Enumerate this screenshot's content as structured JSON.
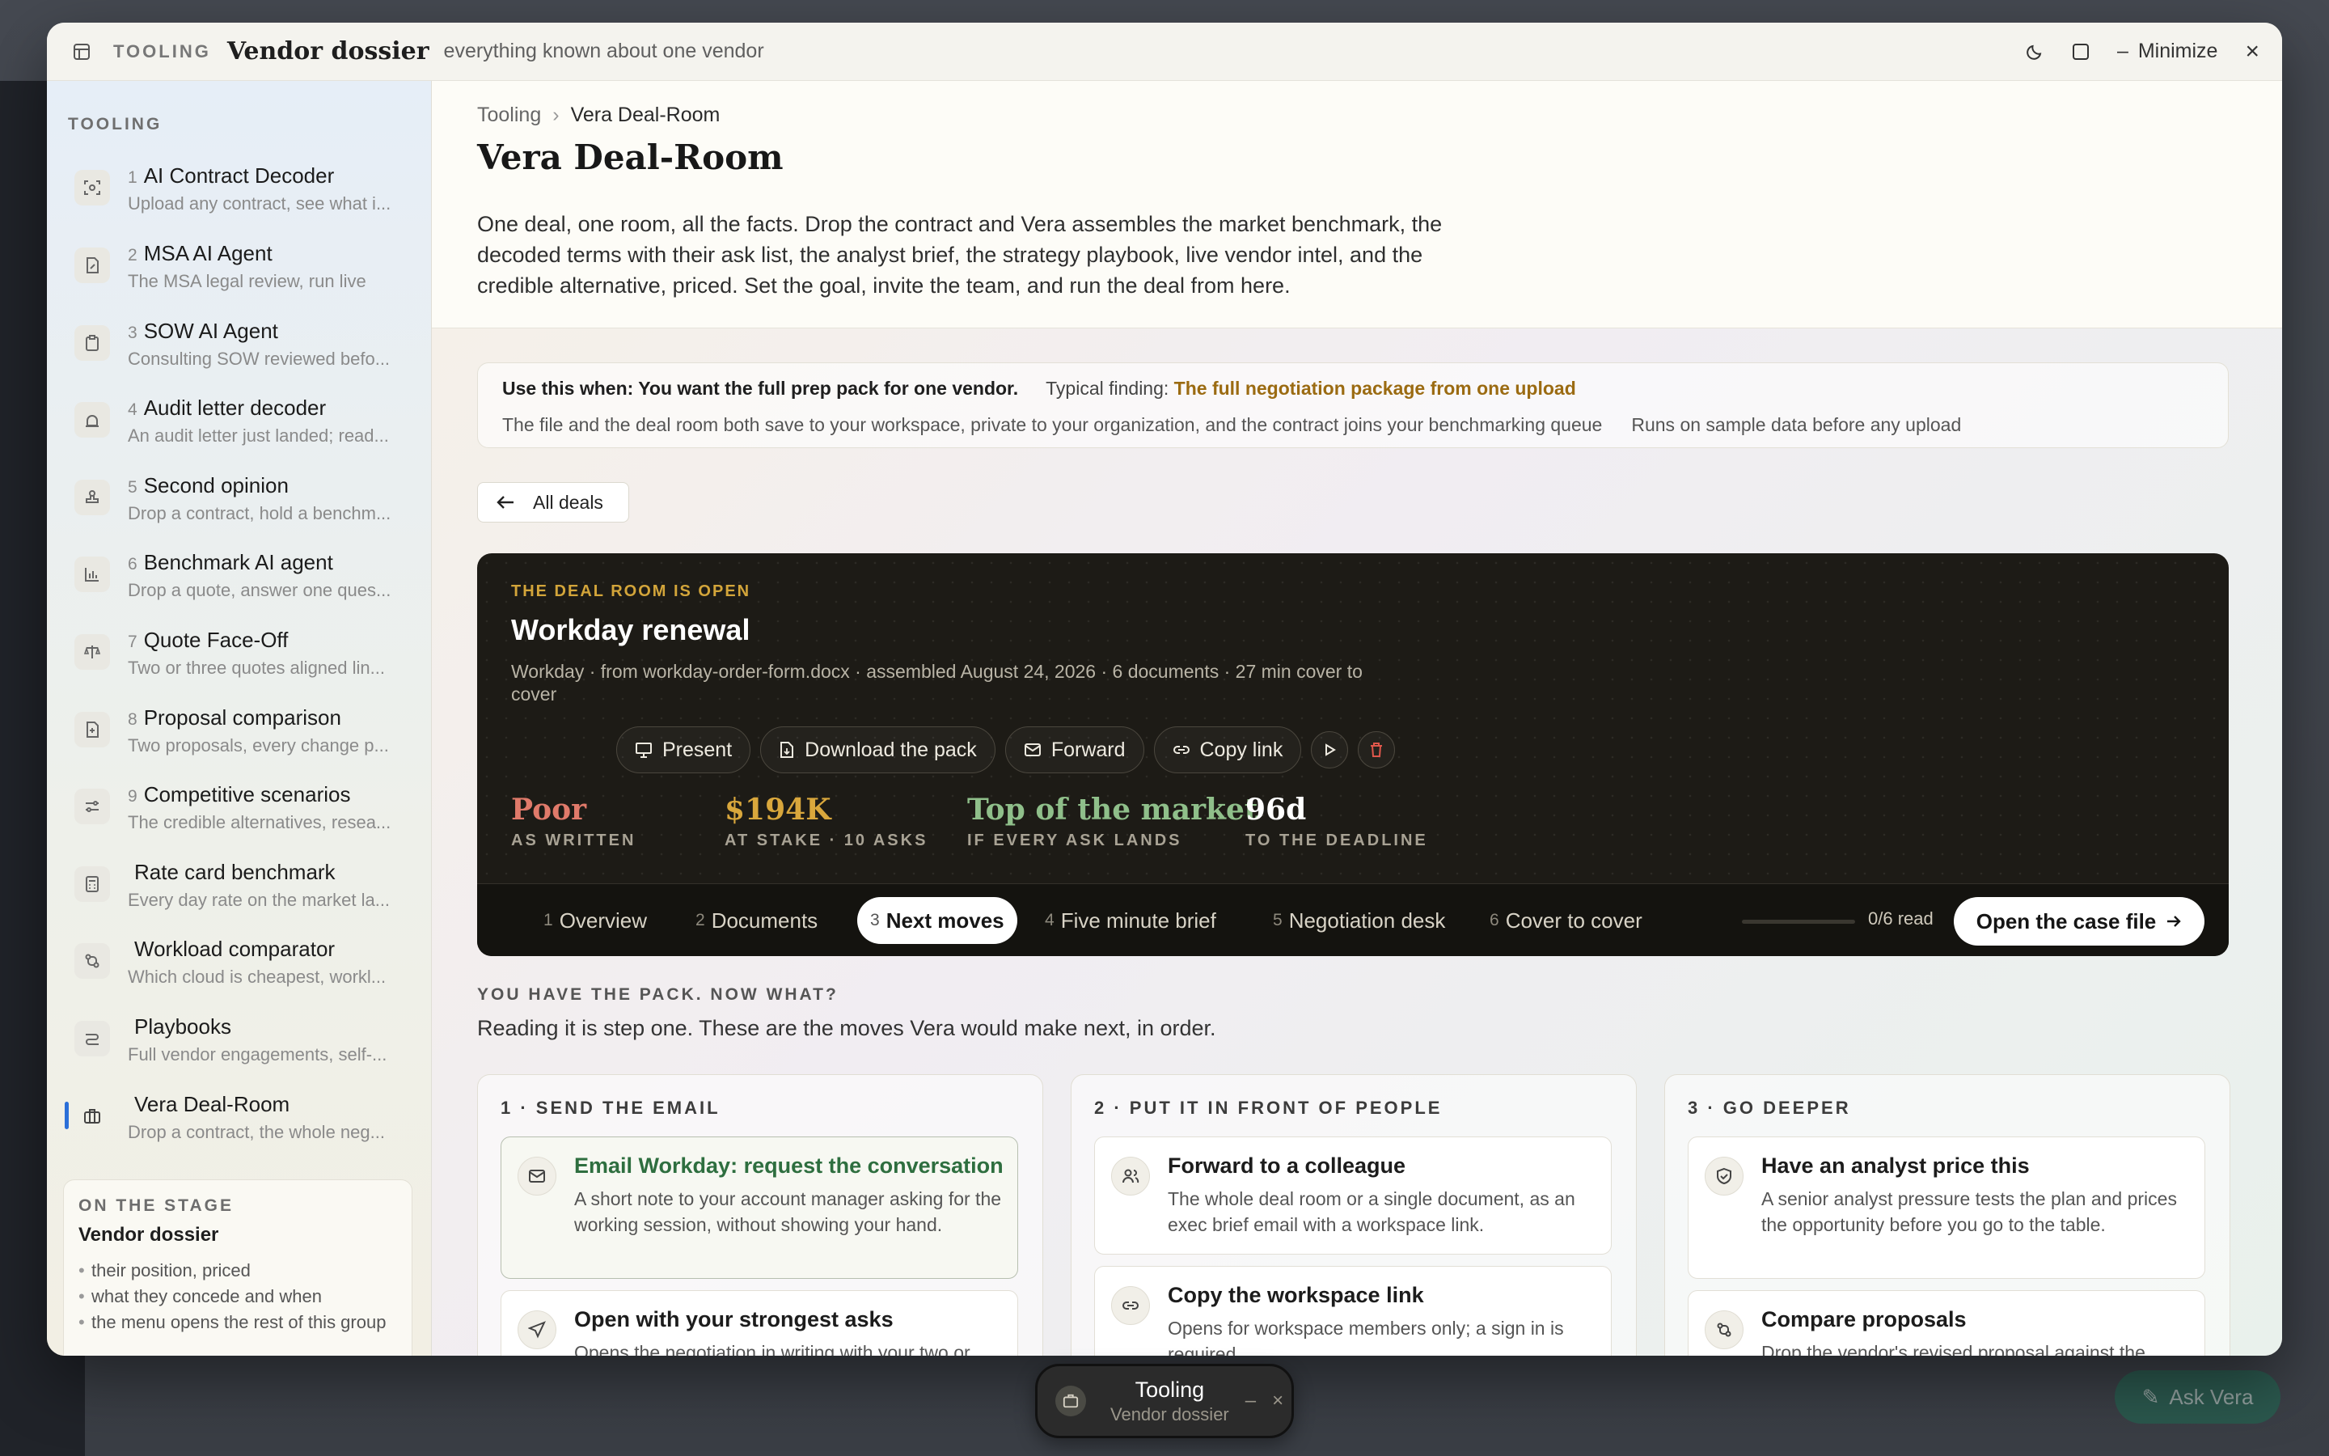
{
  "window": {
    "kicker": "TOOLING",
    "title": "Vendor dossier",
    "subtitle": "everything known about one vendor",
    "minimize_label": "Minimize"
  },
  "sidebar": {
    "heading": "TOOLING",
    "items": [
      {
        "num": "1",
        "title": "AI Contract Decoder",
        "desc": "Upload any contract, see what i...",
        "icon": "scan-icon"
      },
      {
        "num": "2",
        "title": "MSA AI Agent",
        "desc": "The MSA legal review, run live",
        "icon": "document-edit-icon"
      },
      {
        "num": "3",
        "title": "SOW AI Agent",
        "desc": "Consulting SOW reviewed befo...",
        "icon": "clipboard-icon"
      },
      {
        "num": "4",
        "title": "Audit letter decoder",
        "desc": "An audit letter just landed; read...",
        "icon": "alarm-icon"
      },
      {
        "num": "5",
        "title": "Second opinion",
        "desc": "Drop a contract, hold a benchm...",
        "icon": "stamp-icon"
      },
      {
        "num": "6",
        "title": "Benchmark AI agent",
        "desc": "Drop a quote, answer one ques...",
        "icon": "bar-chart-icon"
      },
      {
        "num": "7",
        "title": "Quote Face-Off",
        "desc": "Two or three quotes aligned lin...",
        "icon": "scales-icon"
      },
      {
        "num": "8",
        "title": "Proposal comparison",
        "desc": "Two proposals, every change p...",
        "icon": "file-compare-icon"
      },
      {
        "num": "9",
        "title": "Competitive scenarios",
        "desc": "The credible alternatives, resea...",
        "icon": "sliders-icon"
      },
      {
        "num": "",
        "title": "Rate card benchmark",
        "desc": "Every day rate on the market la...",
        "icon": "calculator-icon"
      },
      {
        "num": "",
        "title": "Workload comparator",
        "desc": "Which cloud is cheapest, workl...",
        "icon": "git-compare-icon"
      },
      {
        "num": "",
        "title": "Playbooks",
        "desc": "Full vendor engagements, self-...",
        "icon": "workflow-icon"
      },
      {
        "num": "",
        "title": "Vera Deal-Room",
        "desc": "Drop a contract, the whole neg...",
        "icon": "briefcase-icon"
      }
    ],
    "stage": {
      "kicker": "ON THE STAGE",
      "title": "Vendor dossier",
      "points": [
        "their position, priced",
        "what they concede and when",
        "the menu opens the rest of this group"
      ]
    }
  },
  "main": {
    "breadcrumb": {
      "parent": "Tooling",
      "current": "Vera Deal-Room"
    },
    "title": "Vera Deal-Room",
    "description": "One deal, one room, all the facts. Drop the contract and Vera assembles the market benchmark, the decoded terms with their ask list, the analyst brief, the strategy playbook, live vendor intel, and the credible alternative, priced. Set the goal, invite the team, and run the deal from here.",
    "use_when": {
      "lead": "Use this when: You want the full prep pack for one vendor.",
      "finding_label": "Typical finding:",
      "finding_value": "The full negotiation package from one upload",
      "note1": "The file and the deal room both save to your workspace, private to your organization, and the contract joins your benchmarking queue",
      "note2": "Runs on sample data before any upload"
    },
    "all_deals_label": "All deals",
    "deal": {
      "kicker": "THE DEAL ROOM IS OPEN",
      "title": "Workday renewal",
      "meta": "Workday · from workday-order-form.docx · assembled August 24, 2026 · 6 documents · 27 min cover to cover",
      "actions": {
        "present": "Present",
        "download": "Download the pack",
        "forward": "Forward",
        "copy": "Copy link"
      },
      "stats": [
        {
          "value": "Poor",
          "label": "AS WRITTEN",
          "color": "#e07a6a"
        },
        {
          "value": "$194K",
          "label": "AT STAKE · 10 ASKS",
          "color": "#d9a73c"
        },
        {
          "value": "Top of the market",
          "label": "IF EVERY ASK LANDS",
          "color": "#8fbf8a"
        },
        {
          "value": "96d",
          "label": "TO THE DEADLINE",
          "color": "#ffffff"
        }
      ],
      "tabs": [
        {
          "num": "1",
          "label": "Overview"
        },
        {
          "num": "2",
          "label": "Documents"
        },
        {
          "num": "3",
          "label": "Next moves"
        },
        {
          "num": "4",
          "label": "Five minute brief"
        },
        {
          "num": "5",
          "label": "Negotiation desk"
        },
        {
          "num": "6",
          "label": "Cover to cover"
        }
      ],
      "read_status": "0/6 read",
      "read_fraction": 0,
      "open_case_label": "Open the case file"
    },
    "next": {
      "kicker": "YOU HAVE THE PACK. NOW WHAT?",
      "subtitle": "Reading it is step one. These are the moves Vera would make next, in order.",
      "columns": [
        {
          "heading": "1 · SEND THE EMAIL",
          "moves": [
            {
              "title": "Email Workday: request the conversation",
              "desc": "A short note to your account manager asking for the working session, without showing your hand."
            },
            {
              "title": "Open with your strongest asks",
              "desc": "Opens the negotiation in writing with your two or three strongest asks, stated as reasonable."
            }
          ]
        },
        {
          "heading": "2 · PUT IT IN FRONT OF PEOPLE",
          "moves": [
            {
              "title": "Forward to a colleague",
              "desc": "The whole deal room or a single document, as an exec brief email with a workspace link."
            },
            {
              "title": "Copy the workspace link",
              "desc": "Opens for workspace members only; a sign in is required."
            }
          ]
        },
        {
          "heading": "3 · GO DEEPER",
          "moves": [
            {
              "title": "Have an analyst price this",
              "desc": "A senior analyst pressure tests the plan and prices the opportunity before you go to the table."
            },
            {
              "title": "Compare proposals",
              "desc": "Drop the vendor's revised proposal against the original and see exactly what changed, the price."
            }
          ]
        }
      ]
    }
  },
  "taskbar": {
    "title": "Tooling",
    "subtitle": "Vendor dossier"
  },
  "background": {
    "ask_label": "Ask Vera"
  }
}
